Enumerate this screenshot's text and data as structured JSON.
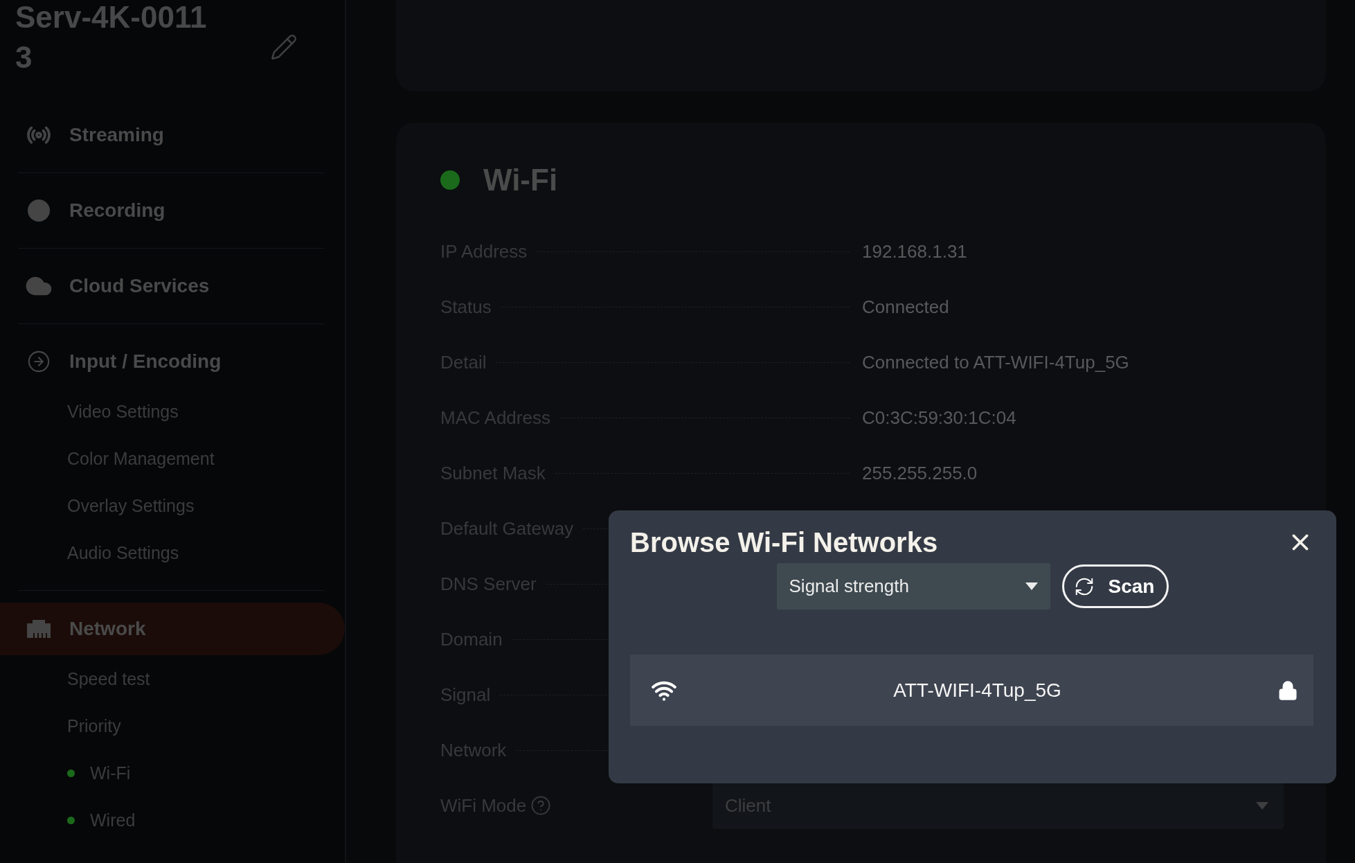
{
  "sidebar": {
    "device_name": "Serv-4K-00113",
    "nav": [
      {
        "label": "Streaming",
        "selected": false
      },
      {
        "label": "Recording",
        "selected": false
      },
      {
        "label": "Cloud Services",
        "selected": false
      },
      {
        "label": "Input / Encoding",
        "selected": false,
        "children": [
          {
            "label": "Video Settings"
          },
          {
            "label": "Color Management"
          },
          {
            "label": "Overlay Settings"
          },
          {
            "label": "Audio Settings"
          }
        ]
      },
      {
        "label": "Network",
        "selected": true,
        "children": [
          {
            "label": "Speed test"
          },
          {
            "label": "Priority"
          },
          {
            "label": "Wi-Fi",
            "color": "#1b6a1b"
          },
          {
            "label": "Wired",
            "color": "#1b6a1b"
          }
        ]
      }
    ]
  },
  "wifi_card": {
    "title": "Wi-Fi",
    "connected": true,
    "rows": [
      {
        "kind": "info",
        "label": "IP Address",
        "value": "192.168.1.31"
      },
      {
        "kind": "info",
        "label": "Status",
        "value": "Connected"
      },
      {
        "kind": "info",
        "label": "Detail",
        "value": "Connected to ATT-WIFI-4Tup_5G"
      },
      {
        "kind": "info",
        "label": "MAC Address",
        "value": "C0:3C:59:30:1C:04"
      },
      {
        "kind": "info",
        "label": "Subnet Mask",
        "value": "255.255.255.0"
      },
      {
        "kind": "info",
        "label": "Default Gateway"
      },
      {
        "kind": "info",
        "label": "DNS Server"
      },
      {
        "kind": "info",
        "label": "Domain"
      },
      {
        "kind": "info",
        "label": "Signal"
      },
      {
        "kind": "info",
        "label": "Network"
      },
      {
        "kind": "select",
        "label": "WiFi Mode",
        "value": "Client"
      }
    ]
  },
  "modal": {
    "title": "Browse Wi-Fi Networks",
    "sort": "Signal strength",
    "scan_label": "Scan",
    "networks": [
      {
        "name": "ATT-WIFI-4Tup_5G",
        "locked": true
      }
    ]
  }
}
